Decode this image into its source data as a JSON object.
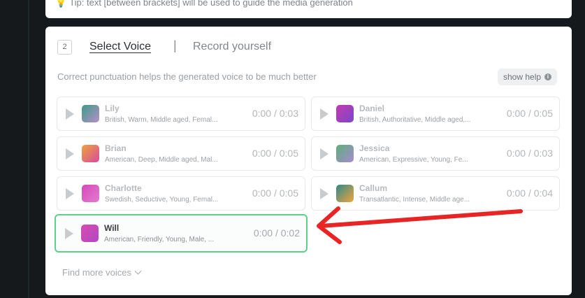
{
  "tip": {
    "text": "Tip: text [between brackets] will be used to guide the media generation"
  },
  "panel": {
    "step_number": "2",
    "tabs": {
      "select": "Select Voice",
      "separator": "|",
      "record": "Record yourself"
    },
    "hint": "Correct punctuation helps the generated voice to be much better",
    "help_label": "show help",
    "find_more": "Find more voices"
  },
  "voices": [
    {
      "name": "Lily",
      "desc": "British, Warm, Middle aged, Femal...",
      "time": "0:00 / 0:03",
      "colors": [
        "#3f9a8a",
        "#b690c9"
      ]
    },
    {
      "name": "Daniel",
      "desc": "British, Authoritative, Middle aged,...",
      "time": "0:00 / 0:05",
      "colors": [
        "#c63ab0",
        "#7a48c8"
      ]
    },
    {
      "name": "Brian",
      "desc": "American, Deep, Middle aged, Mal...",
      "time": "0:00 / 0:05",
      "colors": [
        "#f0a33a",
        "#d64aa0"
      ]
    },
    {
      "name": "Jessica",
      "desc": "American, Expressive, Young, Fe...",
      "time": "0:00 / 0:03",
      "colors": [
        "#5db07a",
        "#a78ad0"
      ]
    },
    {
      "name": "Charlotte",
      "desc": "Swedish, Seductive, Young, Femal...",
      "time": "0:00 / 0:05",
      "colors": [
        "#d44ab8",
        "#e37bd0"
      ]
    },
    {
      "name": "Callum",
      "desc": "Transatlantic, Intense, Middle age...",
      "time": "0:00 / 0:04",
      "colors": [
        "#2e8a8a",
        "#f2a43c"
      ]
    },
    {
      "name": "Will",
      "desc": "American, Friendly, Young, Male, ...",
      "time": "0:00 / 0:02",
      "colors": [
        "#d94ab0",
        "#b04ac4"
      ],
      "selected": true
    }
  ],
  "colors": {
    "selected_border": "#5fcf8b",
    "arrow": "#e82424"
  }
}
